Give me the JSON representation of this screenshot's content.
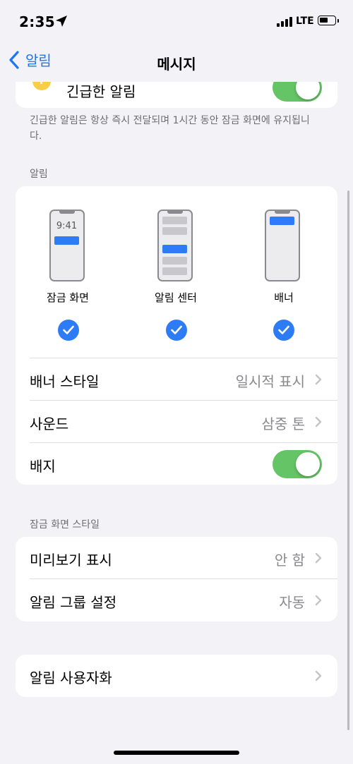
{
  "status": {
    "time": "2:35",
    "network": "LTE",
    "battery_level": 0.45
  },
  "nav": {
    "back_label": "알림",
    "title": "메시지"
  },
  "top_card": {
    "label": "긴급한 알림",
    "toggle_on": true
  },
  "footnote": "긴급한 알림은 항상 즉시 전달되며 1시간 동안 잠금 화면에 유지됩니다.",
  "alerts": {
    "header": "알림",
    "options": [
      {
        "label": "잠금 화면",
        "preview_time": "9:41",
        "checked": true
      },
      {
        "label": "알림 센터",
        "checked": true
      },
      {
        "label": "배너",
        "checked": true
      }
    ],
    "banner_style": {
      "label": "배너 스타일",
      "value": "일시적 표시"
    },
    "sound": {
      "label": "사운드",
      "value": "삼중 톤"
    },
    "badges": {
      "label": "배지",
      "toggle_on": true
    }
  },
  "lock_screen_style": {
    "header": "잠금 화면 스타일",
    "show_previews": {
      "label": "미리보기 표시",
      "value": "안 함"
    },
    "grouping": {
      "label": "알림 그룹 설정",
      "value": "자동"
    }
  },
  "customize": {
    "label": "알림 사용자화"
  },
  "colors": {
    "accent": "#1a78f2",
    "toggle_on": "#65c466",
    "check": "#2d7cf6",
    "background": "#f2f2f7"
  }
}
